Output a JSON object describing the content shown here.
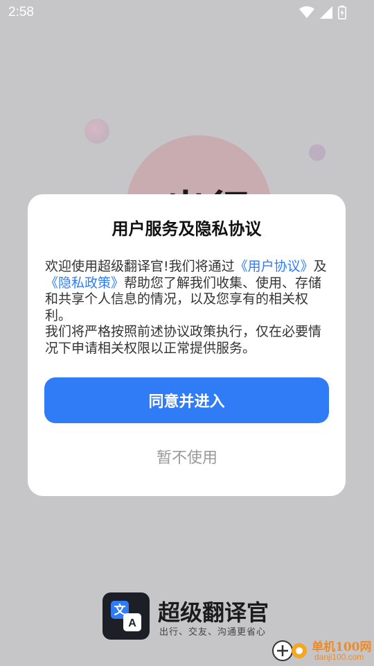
{
  "status_bar": {
    "time": "2:58",
    "icons": [
      "wifi-icon",
      "signal-icon",
      "battery-charging-icon"
    ]
  },
  "background": {
    "partial_text": "出行"
  },
  "dialog": {
    "title": "用户服务及隐私协议",
    "body": {
      "p1_pre": "欢迎使用超级翻译官!我们将通过",
      "link_user_agreement": "《用户协议》",
      "p1_and": "及",
      "link_privacy_policy": "《隐私政策》",
      "p1_post": "帮助您了解我们收集、使用、存储和共享个人信息的情况，以及您享有的相关权利。",
      "p2": "我们将严格按照前述协议政策执行，仅在必要情况下申请相关权限以正常提供服务。"
    },
    "agree_label": "同意并进入",
    "decline_label": "暂不使用",
    "colors": {
      "accent": "#2f7cf6",
      "muted": "#999999"
    }
  },
  "brand": {
    "name": "超级翻译官",
    "slogan": "出行、交友、沟通更省心",
    "logo_glyph_1": "文",
    "logo_glyph_2": "A"
  },
  "watermark": {
    "cn": "单机100网",
    "en": "danji100.com"
  }
}
